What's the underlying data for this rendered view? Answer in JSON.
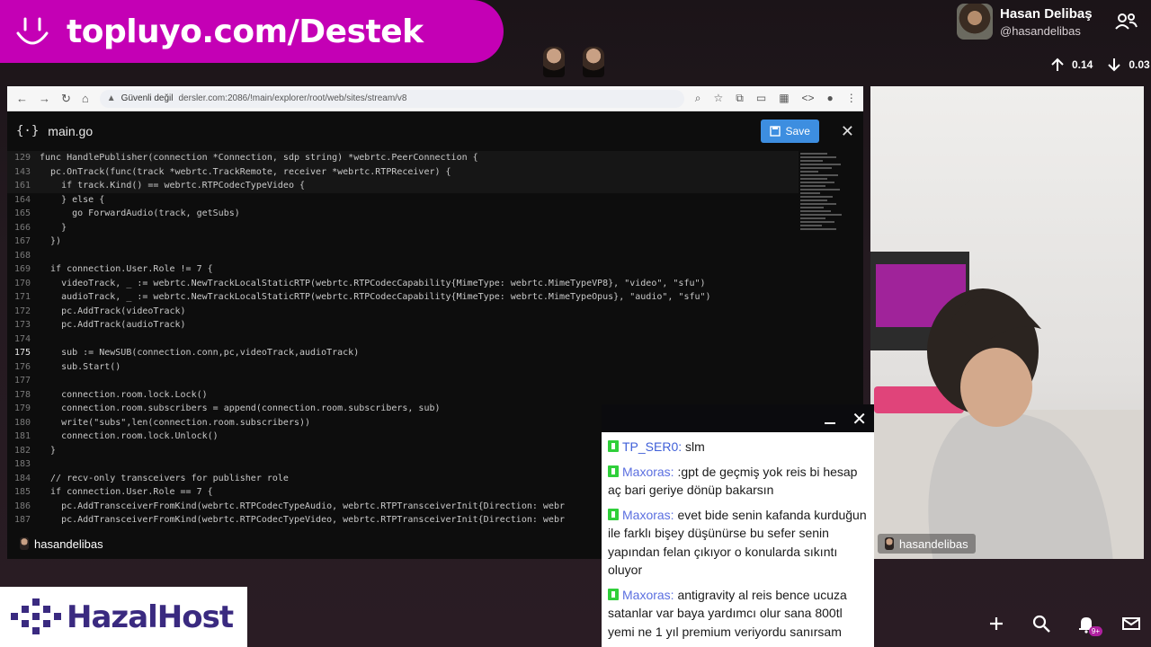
{
  "banner": {
    "text": "topluyo.com/Destek"
  },
  "profile": {
    "name": "Hasan Delibaş",
    "handle": "@hasandelibas"
  },
  "network": {
    "up": "0.14",
    "down": "0.03"
  },
  "browser": {
    "secure_label": "Güvenli değil",
    "url": "dersler.com:2086/!main/explorer/root/web/sites/stream/v8"
  },
  "editor": {
    "file_icon": "{·}",
    "file_name": "main.go",
    "save_label": "Save",
    "lines": [
      {
        "n": "129",
        "t": "func HandlePublisher(connection *Connection, sdp string) *webrtc.PeerConnection {",
        "sticky": true
      },
      {
        "n": "143",
        "t": "  pc.OnTrack(func(track *webrtc.TrackRemote, receiver *webrtc.RTPReceiver) {",
        "sticky": true
      },
      {
        "n": "161",
        "t": "    if track.Kind() == webrtc.RTPCodecTypeVideo {",
        "sticky": true
      },
      {
        "n": "164",
        "t": "    } else {"
      },
      {
        "n": "165",
        "t": "      go ForwardAudio(track, getSubs)"
      },
      {
        "n": "166",
        "t": "    }"
      },
      {
        "n": "167",
        "t": "  })"
      },
      {
        "n": "168",
        "t": ""
      },
      {
        "n": "169",
        "t": "  if connection.User.Role != 7 {"
      },
      {
        "n": "170",
        "t": "    videoTrack, _ := webrtc.NewTrackLocalStaticRTP(webrtc.RTPCodecCapability{MimeType: webrtc.MimeTypeVP8}, \"video\", \"sfu\")"
      },
      {
        "n": "171",
        "t": "    audioTrack, _ := webrtc.NewTrackLocalStaticRTP(webrtc.RTPCodecCapability{MimeType: webrtc.MimeTypeOpus}, \"audio\", \"sfu\")"
      },
      {
        "n": "172",
        "t": "    pc.AddTrack(videoTrack)"
      },
      {
        "n": "173",
        "t": "    pc.AddTrack(audioTrack)"
      },
      {
        "n": "174",
        "t": ""
      },
      {
        "n": "175",
        "t": "    sub := NewSUB(connection.conn,pc,videoTrack,audioTrack)",
        "cur": true
      },
      {
        "n": "176",
        "t": "    sub.Start()"
      },
      {
        "n": "177",
        "t": ""
      },
      {
        "n": "178",
        "t": "    connection.room.lock.Lock()"
      },
      {
        "n": "179",
        "t": "    connection.room.subscribers = append(connection.room.subscribers, sub)"
      },
      {
        "n": "180",
        "t": "    write(\"subs\",len(connection.room.subscribers))"
      },
      {
        "n": "181",
        "t": "    connection.room.lock.Unlock()"
      },
      {
        "n": "182",
        "t": "  }"
      },
      {
        "n": "183",
        "t": ""
      },
      {
        "n": "184",
        "t": "  // recv-only transceivers for publisher role"
      },
      {
        "n": "185",
        "t": "  if connection.User.Role == 7 {"
      },
      {
        "n": "186",
        "t": "    pc.AddTransceiverFromKind(webrtc.RTPCodecTypeAudio, webrtc.RTPTransceiverInit{Direction: webr"
      },
      {
        "n": "187",
        "t": "    pc.AddTransceiverFromKind(webrtc.RTPCodecTypeVideo, webrtc.RTPTransceiverInit{Direction: webr"
      }
    ]
  },
  "screen_tag": "hasandelibas",
  "cam_tag": "hasandelibas",
  "chat": {
    "messages": [
      {
        "user": "TP_SER0:",
        "text": " slm"
      },
      {
        "user": "Maxoras:",
        "text": " :gpt de geçmiş yok reis bi hesap aç bari geriye dönüp bakarsın"
      },
      {
        "user": "Maxoras:",
        "text": " evet bide senin kafanda kurduğun ile farklı bişey düşünürse bu sefer senin yapından felan çıkıyor o konularda sıkıntı oluyor"
      },
      {
        "user": "Maxoras:",
        "text": " antigravity al reis bence ucuza satanlar var baya yardımcı olur sana 800tl yemi ne 1 yıl premium veriyordu sanırsam"
      }
    ]
  },
  "logo": {
    "text": "HazalHost"
  },
  "notifications": {
    "badge": "9+"
  },
  "colors": {
    "banner": "#c400b5",
    "save": "#3d8ee0",
    "kick": "#2fcf3a",
    "chat_user": "#5b6fe0"
  }
}
